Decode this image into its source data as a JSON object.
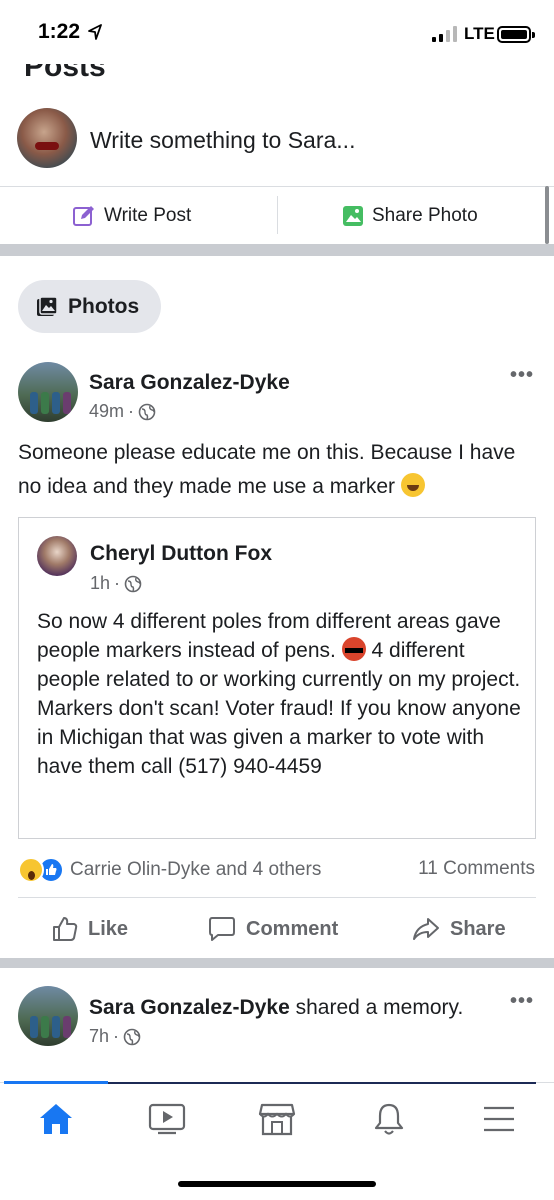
{
  "status_bar": {
    "time": "1:22",
    "network": "LTE"
  },
  "section": {
    "title": "Posts"
  },
  "composer": {
    "placeholder": "Write something to Sara...",
    "write_post_label": "Write Post",
    "share_photo_label": "Share Photo"
  },
  "photos_button": {
    "label": "Photos"
  },
  "post": {
    "author": "Sara Gonzalez-Dyke",
    "time": "49m",
    "text": "Someone please educate me on this. Because I have no idea and they made me use a marker",
    "shared": {
      "author": "Cheryl Dutton Fox",
      "time": "1h",
      "text_part1": "So now 4 different poles from different areas gave people markers instead of pens.",
      "text_part2": "4 different people related to or working currently on my project.  Markers don't scan!  Voter fraud!  If you know anyone in Michigan that was given a marker to vote with have them call (517) 940-4459"
    },
    "reactions_text": "Carrie Olin-Dyke and 4 others",
    "comments_text": "11 Comments",
    "actions": {
      "like": "Like",
      "comment": "Comment",
      "share": "Share"
    }
  },
  "post2": {
    "author": "Sara Gonzalez-Dyke",
    "action": "shared a memory.",
    "time": "7h"
  },
  "colors": {
    "facebook_blue": "#1877f2",
    "secondary_text": "#65676b",
    "separator": "#c9ccd1"
  },
  "icons": {
    "nav": [
      "home-icon",
      "watch-icon",
      "marketplace-icon",
      "notifications-icon",
      "menu-icon"
    ]
  }
}
